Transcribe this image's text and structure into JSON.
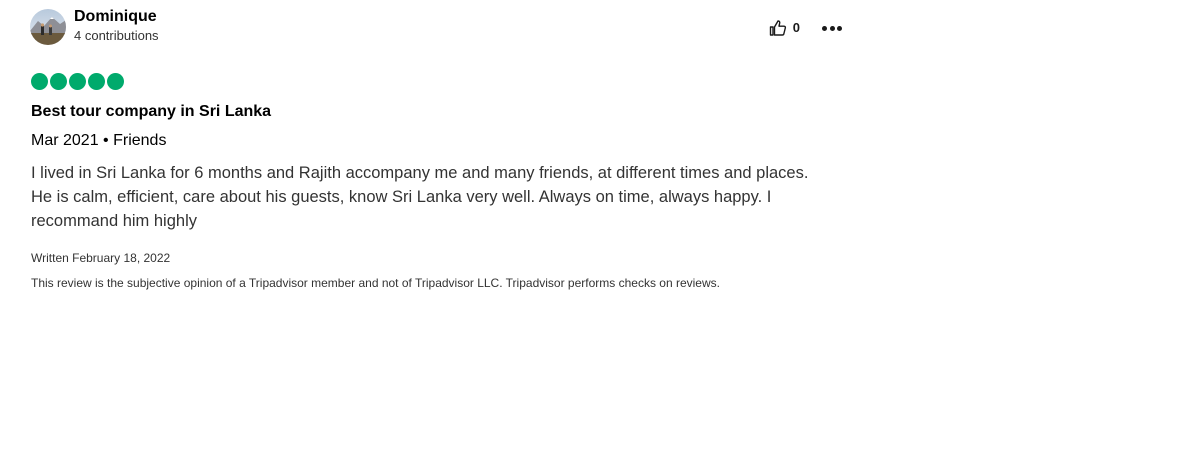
{
  "review": {
    "author": {
      "name": "Dominique",
      "contributions": "4 contributions"
    },
    "helpful_count": "0",
    "rating": {
      "value": 5,
      "max": 5,
      "color": "#00aa6c"
    },
    "title": "Best tour company in Sri Lanka",
    "meta": "Mar 2021 • Friends",
    "body": "I lived in Sri Lanka for 6 months and Rajith accompany me and many friends, at different times and places. He is calm, efficient, care about his guests, know Sri Lanka very well. Always on time, always happy. I recommand him highly",
    "written": "Written February 18, 2022",
    "disclaimer": "This review is the subjective opinion of a Tripadvisor member and not of Tripadvisor LLC. Tripadvisor performs checks on reviews."
  },
  "icons": {
    "helpful": "thumbs-up-icon",
    "more": "more-options-icon"
  }
}
